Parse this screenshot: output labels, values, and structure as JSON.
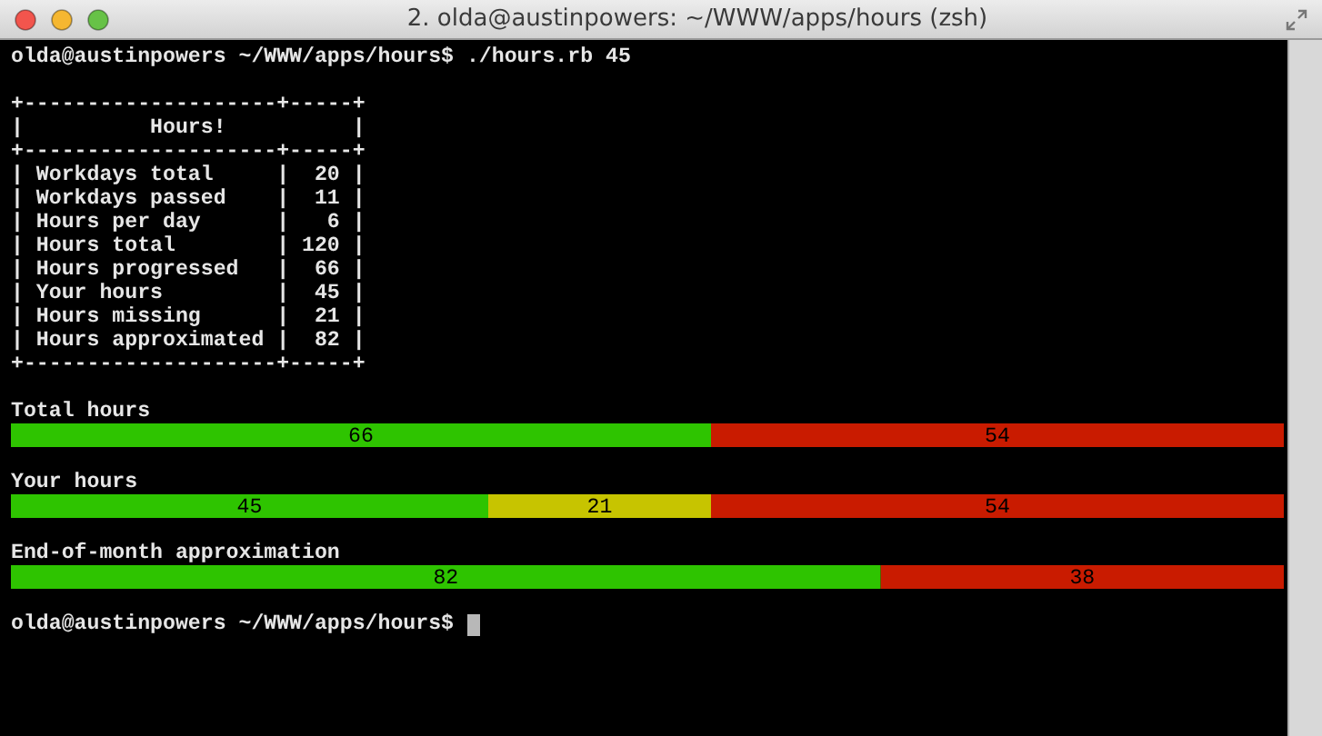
{
  "window": {
    "title": "2. olda@austinpowers: ~/WWW/apps/hours (zsh)"
  },
  "terminal": [
    {
      "kind": "text",
      "text": "olda@austinpowers ~/WWW/apps/hours$ ./hours.rb 45"
    },
    {
      "kind": "blank"
    },
    {
      "kind": "text",
      "text": "+--------------------+-----+"
    },
    {
      "kind": "text",
      "text": "|          Hours!          |"
    },
    {
      "kind": "text",
      "text": "+--------------------+-----+"
    },
    {
      "kind": "text",
      "text": "| Workdays total     |  20 |"
    },
    {
      "kind": "text",
      "text": "| Workdays passed    |  11 |"
    },
    {
      "kind": "text",
      "text": "| Hours per day      |   6 |"
    },
    {
      "kind": "text",
      "text": "| Hours total        | 120 |"
    },
    {
      "kind": "text",
      "text": "| Hours progressed   |  66 |"
    },
    {
      "kind": "text",
      "text": "| Your hours         |  45 |"
    },
    {
      "kind": "text",
      "text": "| Hours missing      |  21 |"
    },
    {
      "kind": "text",
      "text": "| Hours approximated |  82 |"
    },
    {
      "kind": "text",
      "text": "+--------------------+-----+"
    },
    {
      "kind": "blank"
    },
    {
      "kind": "chart",
      "chart_data": {
        "type": "bar",
        "orientation": "horizontal",
        "stacked": true,
        "title": "Total hours",
        "data_labels": true,
        "series": [
          {
            "color": "#2ec400",
            "values": [
              66
            ]
          },
          {
            "color": "#c91b00",
            "values": [
              54
            ]
          }
        ]
      }
    },
    {
      "kind": "blank"
    },
    {
      "kind": "chart",
      "chart_data": {
        "type": "bar",
        "orientation": "horizontal",
        "stacked": true,
        "title": "Your hours",
        "data_labels": true,
        "series": [
          {
            "color": "#2ec400",
            "values": [
              45
            ]
          },
          {
            "color": "#c7c400",
            "values": [
              21
            ]
          },
          {
            "color": "#c91b00",
            "values": [
              54
            ]
          }
        ]
      }
    },
    {
      "kind": "blank"
    },
    {
      "kind": "chart",
      "chart_data": {
        "type": "bar",
        "orientation": "horizontal",
        "stacked": true,
        "title": "End-of-month approximation",
        "data_labels": true,
        "series": [
          {
            "color": "#2ec400",
            "values": [
              82
            ]
          },
          {
            "color": "#c91b00",
            "values": [
              38
            ]
          }
        ]
      }
    },
    {
      "kind": "blank"
    },
    {
      "kind": "prompt",
      "text": "olda@austinpowers ~/WWW/apps/hours$"
    }
  ]
}
